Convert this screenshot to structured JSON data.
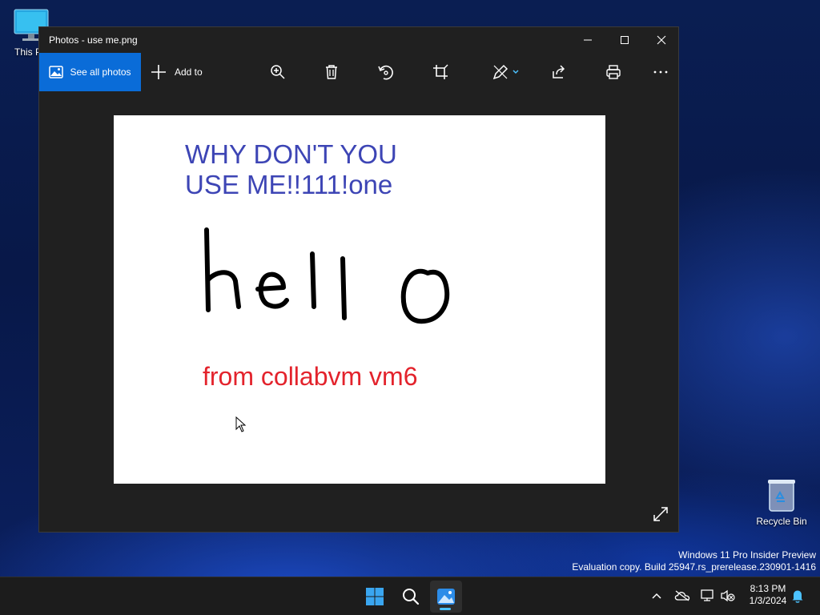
{
  "desktop": {
    "this_pc_label": "This PC",
    "recycle_bin_label": "Recycle Bin"
  },
  "window": {
    "title": "Photos - use me.png",
    "toolbar": {
      "see_all_label": "See all photos",
      "add_to_label": "Add to"
    }
  },
  "image": {
    "line1": "WHY DON'T YOU",
    "line2": "USE ME!!111!one",
    "handwriting": "hello",
    "caption": "from collabvm vm6"
  },
  "watermark": {
    "line1": "Windows 11 Pro Insider Preview",
    "line2": "Evaluation copy. Build 25947.rs_prerelease.230901-1416"
  },
  "taskbar": {
    "time": "8:13 PM",
    "date": "1/3/2024"
  },
  "colors": {
    "accent": "#0a6cd8",
    "image_heading": "#3d45b5",
    "image_caption": "#e3232c",
    "taskbar_indicator": "#4cc2ff"
  }
}
